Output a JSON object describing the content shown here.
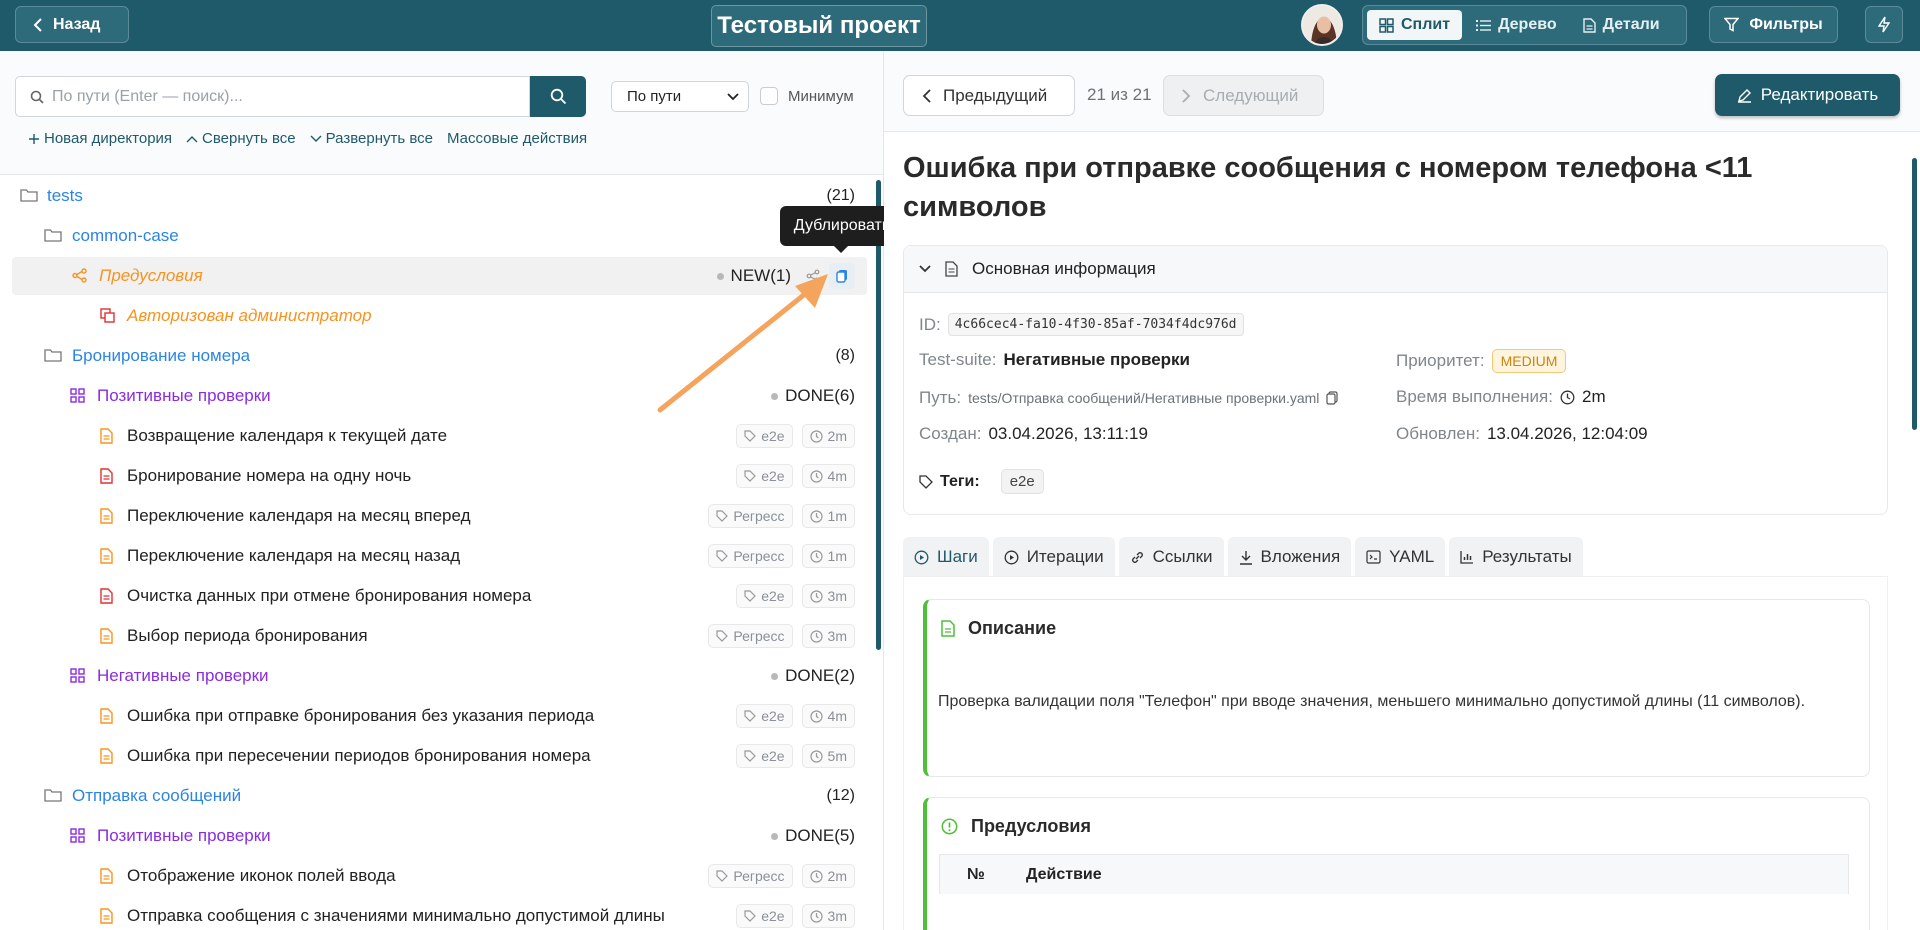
{
  "colors": {
    "brand": "#1f5a6a",
    "accent_orange": "#f7931e",
    "purple": "#8a2be2",
    "blue": "#2b85e4",
    "green": "#4ec037",
    "red": "#e03131"
  },
  "topbar": {
    "back_label": "Назад",
    "project_title": "Тестовый проект",
    "view_split": "Сплит",
    "view_tree": "Дерево",
    "view_details": "Детали",
    "filters": "Фильтры"
  },
  "left": {
    "search_placeholder": "По пути (Enter — поиск)...",
    "sort_select": "По пути",
    "minimum_label": "Минимум",
    "actions": [
      "Новая директория",
      "Свернуть все",
      "Развернуть все",
      "Массовые действия"
    ],
    "tree": [
      {
        "label": "tests",
        "right": "(21)"
      },
      {
        "label": "common-case"
      },
      {
        "label": "Предусловия",
        "status": "NEW(1)"
      },
      {
        "label": "Авторизован администратор"
      },
      {
        "label": "Бронирование номера",
        "right": "(8)"
      },
      {
        "label": "Позитивные проверки",
        "status": "DONE(6)"
      },
      {
        "label": "Возвращение календаря к текущей дате",
        "tag": "e2e",
        "time": "2m"
      },
      {
        "label": "Бронирование номера на одну ночь",
        "tag": "e2e",
        "time": "4m"
      },
      {
        "label": "Переключение календаря на месяц вперед",
        "tag": "Регресс",
        "time": "1m"
      },
      {
        "label": "Переключение календаря на месяц назад",
        "tag": "Регресс",
        "time": "1m"
      },
      {
        "label": "Очистка данных при отмене бронирования номера",
        "tag": "e2e",
        "time": "3m"
      },
      {
        "label": "Выбор периода бронирования",
        "tag": "Регресс",
        "time": "3m"
      },
      {
        "label": "Негативные проверки",
        "status": "DONE(2)"
      },
      {
        "label": "Ошибка при отправке бронирования без указания периода",
        "tag": "e2e",
        "time": "4m"
      },
      {
        "label": "Ошибка при пересечении периодов бронирования номера",
        "tag": "e2e",
        "time": "5m"
      },
      {
        "label": "Отправка сообщений",
        "right": "(12)"
      },
      {
        "label": "Позитивные проверки",
        "status": "DONE(5)"
      },
      {
        "label": "Отображение иконок полей ввода",
        "tag": "Регресс",
        "time": "2m"
      },
      {
        "label": "Отправка сообщения с значениями минимально допустимой длины",
        "tag": "e2e",
        "time": "3m"
      }
    ],
    "tooltip": "Дублировать"
  },
  "right": {
    "prev": "Предыдущий",
    "counter": "21 из 21",
    "next": "Следующий",
    "edit": "Редактировать",
    "title": "Ошибка при отправке сообщения с номером телефона <11 символов",
    "info": {
      "header": "Основная информация",
      "id_label": "ID:",
      "id": "4c66cec4-fa10-4f30-85af-7034f4dc976d",
      "suite_label": "Test-suite:",
      "suite": "Негативные проверки",
      "priority_label": "Приоритет:",
      "priority": "MEDIUM",
      "path_label": "Путь:",
      "path": "tests/Отправка сообщений/Негативные проверки.yaml",
      "duration_label": "Время выполнения:",
      "duration": "2m",
      "created_label": "Создан:",
      "created": "03.04.2026, 13:11:19",
      "updated_label": "Обновлен:",
      "updated": "13.04.2026, 12:04:09",
      "tags_label": "Теги:",
      "tag": "e2e"
    },
    "tabs": [
      "Шаги",
      "Итерации",
      "Ссылки",
      "Вложения",
      "YAML",
      "Результаты"
    ],
    "description_title": "Описание",
    "description_text": "Проверка валидации поля \"Телефон\" при вводе значения, меньшего минимально допустимой длины (11 символов).",
    "preconditions_title": "Предусловия",
    "col_num": "№",
    "col_action": "Действие"
  }
}
